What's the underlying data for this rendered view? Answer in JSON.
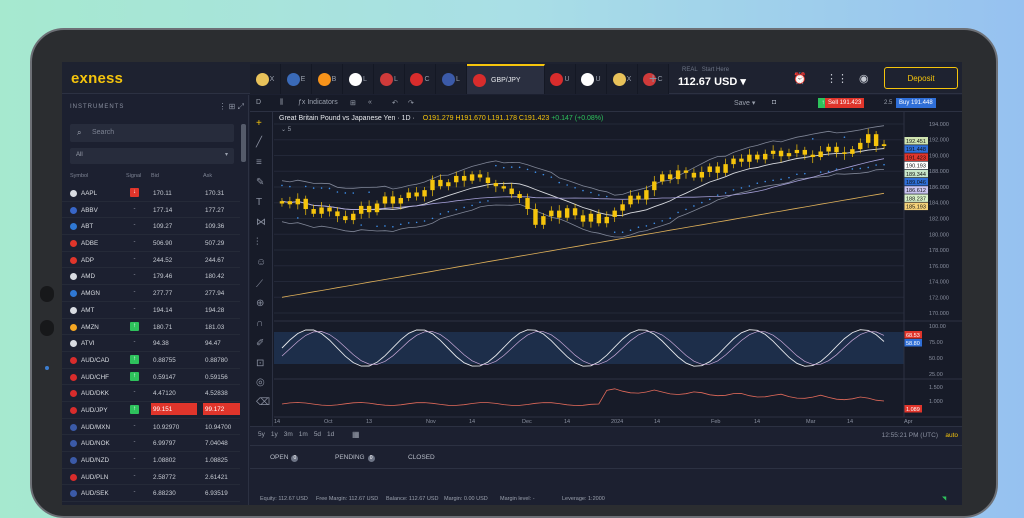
{
  "logo": "exness",
  "tabs": [
    {
      "label": "X",
      "color": "#e8c25a"
    },
    {
      "label": "E",
      "color": "#3a6ab8"
    },
    {
      "label": "B",
      "color": "#f7931a"
    },
    {
      "label": "L",
      "color": "#ffffff"
    },
    {
      "label": "L",
      "color": "#cf3a3a"
    },
    {
      "label": "C",
      "color": "#d82c2c"
    },
    {
      "label": "L",
      "color": "#3b5aa8"
    }
  ],
  "active_tab": "GBP/JPY",
  "tabs_after": [
    {
      "label": "U",
      "color": "#d82c2c"
    },
    {
      "label": "U",
      "color": "#ffffff"
    },
    {
      "label": "X",
      "color": "#e8c25a"
    },
    {
      "label": "C",
      "color": "#cf3a3a"
    }
  ],
  "account": {
    "type": "REAL",
    "hint": "Start Here",
    "balance": "112.67 USD"
  },
  "deposit_label": "Deposit",
  "instruments": {
    "title": "INSTRUMENTS",
    "search_placeholder": "Search",
    "filter": "All",
    "columns": {
      "symbol": "Symbol",
      "signal": "Signal",
      "bid": "Bid",
      "ask": "Ask"
    },
    "rows": [
      {
        "symbol": "AAPL",
        "signal": "down",
        "bid": "170.11",
        "ask": "170.31",
        "color": "#d9dce2"
      },
      {
        "symbol": "ABBV",
        "signal": "-",
        "bid": "177.14",
        "ask": "177.27",
        "color": "#3866c8"
      },
      {
        "symbol": "ABT",
        "signal": "-",
        "bid": "109.27",
        "ask": "109.36",
        "color": "#2f78d4"
      },
      {
        "symbol": "ADBE",
        "signal": "-",
        "bid": "506.90",
        "ask": "507.29",
        "color": "#e0352b"
      },
      {
        "symbol": "ADP",
        "signal": "-",
        "bid": "244.52",
        "ask": "244.67",
        "color": "#e0352b"
      },
      {
        "symbol": "AMD",
        "signal": "-",
        "bid": "179.46",
        "ask": "180.42",
        "color": "#d9dce2"
      },
      {
        "symbol": "AMGN",
        "signal": "-",
        "bid": "277.77",
        "ask": "277.94",
        "color": "#2f78d4"
      },
      {
        "symbol": "AMT",
        "signal": "-",
        "bid": "194.14",
        "ask": "194.28",
        "color": "#d9dce2"
      },
      {
        "symbol": "AMZN",
        "signal": "up",
        "bid": "180.71",
        "ask": "181.03",
        "color": "#f5a623"
      },
      {
        "symbol": "ATVI",
        "signal": "-",
        "bid": "94.38",
        "ask": "94.47",
        "color": "#d9dce2"
      },
      {
        "symbol": "AUD/CAD",
        "signal": "up",
        "bid": "0.88755",
        "ask": "0.88780",
        "color": "#d82c2c"
      },
      {
        "symbol": "AUD/CHF",
        "signal": "up",
        "bid": "0.59147",
        "ask": "0.59156",
        "color": "#d82c2c"
      },
      {
        "symbol": "AUD/DKK",
        "signal": "-",
        "bid": "4.47120",
        "ask": "4.52838",
        "color": "#d82c2c"
      },
      {
        "symbol": "AUD/JPY",
        "signal": "up",
        "bid": "99.151",
        "ask": "99.172",
        "color": "#d82c2c",
        "highlight": true
      },
      {
        "symbol": "AUD/MXN",
        "signal": "-",
        "bid": "10.92970",
        "ask": "10.94700",
        "color": "#3b5aa8"
      },
      {
        "symbol": "AUD/NOK",
        "signal": "-",
        "bid": "6.99797",
        "ask": "7.04048",
        "color": "#3b5aa8"
      },
      {
        "symbol": "AUD/NZD",
        "signal": "-",
        "bid": "1.08802",
        "ask": "1.08825",
        "color": "#3b5aa8"
      },
      {
        "symbol": "AUD/PLN",
        "signal": "-",
        "bid": "2.58772",
        "ask": "2.61421",
        "color": "#d82c2c"
      },
      {
        "symbol": "AUD/SEK",
        "signal": "-",
        "bid": "6.88230",
        "ask": "6.93519",
        "color": "#3b5aa8"
      }
    ]
  },
  "chart_toolbar": {
    "interval": "D",
    "indicators": "Indicators",
    "save": "Save",
    "sell": "Sell 191.423",
    "spread": "2.5",
    "buy": "Buy 191.448"
  },
  "chart_legend": {
    "title": "Great Britain Pound vs Japanese Yen · 1D ·",
    "ohlc": "O191.279 H191.670 L191.178 C191.423",
    "change": "+0.147 (+0.08%)",
    "studies": "5"
  },
  "chart_data": {
    "type": "candlestick",
    "symbol": "GBP/JPY",
    "interval": "1D",
    "price_axis_ticks": [
      "194.000",
      "192.000",
      "190.000",
      "188.000",
      "186.000",
      "184.000",
      "182.000",
      "180.000",
      "178.000",
      "176.000",
      "174.000",
      "172.000",
      "170.000"
    ],
    "price_range": [
      169.5,
      194.5
    ],
    "price_labels": [
      {
        "value": "192.451",
        "color": "#cfe3b0"
      },
      {
        "value": "191.448",
        "color": "#2f6fd8"
      },
      {
        "value": "191.423",
        "color": "#e0352b"
      },
      {
        "value": "190.193",
        "color": "#ffffff"
      },
      {
        "value": "189.344",
        "color": "#c8e6c9"
      },
      {
        "value": "189.046",
        "color": "#2f6fd8"
      },
      {
        "value": "186.612",
        "color": "#c9c3f0"
      },
      {
        "value": "188.237",
        "color": "#d7f0c8"
      },
      {
        "value": "185.193",
        "color": "#f5d27a"
      }
    ],
    "close_prices": [
      184.2,
      183.8,
      184.5,
      183.2,
      182.6,
      183.4,
      182.9,
      182.3,
      181.8,
      182.6,
      183.6,
      182.8,
      183.9,
      184.8,
      183.9,
      184.6,
      185.3,
      184.8,
      185.6,
      186.9,
      186.1,
      186.6,
      187.4,
      186.8,
      187.6,
      187.2,
      186.5,
      186.1,
      185.8,
      185.1,
      184.6,
      183.2,
      181.2,
      182.3,
      183.0,
      182.1,
      183.3,
      182.4,
      181.6,
      182.6,
      181.4,
      182.2,
      183.0,
      183.8,
      184.9,
      184.4,
      185.6,
      186.7,
      187.6,
      187.0,
      188.1,
      187.8,
      187.2,
      187.9,
      188.6,
      187.8,
      188.9,
      189.6,
      189.2,
      190.1,
      189.5,
      190.2,
      190.6,
      189.9,
      190.3,
      190.7,
      190.1,
      189.8,
      190.5,
      191.1,
      190.4,
      190.2,
      190.8,
      191.6,
      192.7,
      191.2,
      191.423
    ],
    "indicator_bands": [
      "Bollinger Bands",
      "Moving Averages",
      "Parabolic SAR"
    ],
    "stochastic": {
      "ticks": [
        "100.00",
        "75.00",
        "50.00",
        "25.00"
      ],
      "labels": [
        {
          "value": "68.53",
          "color": "#e0352b"
        },
        {
          "value": "58.80",
          "color": "#2f6fd8"
        }
      ]
    },
    "lower_indicator": {
      "ticks": [
        "1.500",
        "1.000"
      ],
      "label": {
        "value": "1.089",
        "color": "#e0352b"
      }
    },
    "x_ticks": [
      "14",
      "Oct",
      "13",
      "Nov",
      "14",
      "Dec",
      "14",
      "2024",
      "14",
      "Feb",
      "14",
      "Mar",
      "14",
      "Apr"
    ]
  },
  "time_range": [
    "5y",
    "1y",
    "3m",
    "1m",
    "5d",
    "1d"
  ],
  "clock": "12:55:21 PM (UTC)",
  "auto": "auto",
  "order_tabs": {
    "open": "OPEN",
    "open_count": "0",
    "pending": "PENDING",
    "pending_count": "0",
    "closed": "CLOSED"
  },
  "status": {
    "equity": "Equity: 112.67 USD",
    "free_margin": "Free Margin: 112.67 USD",
    "balance": "Balance: 112.67 USD",
    "margin": "Margin: 0.00 USD",
    "margin_level": "Margin level: -",
    "leverage": "Leverage: 1:2000"
  }
}
